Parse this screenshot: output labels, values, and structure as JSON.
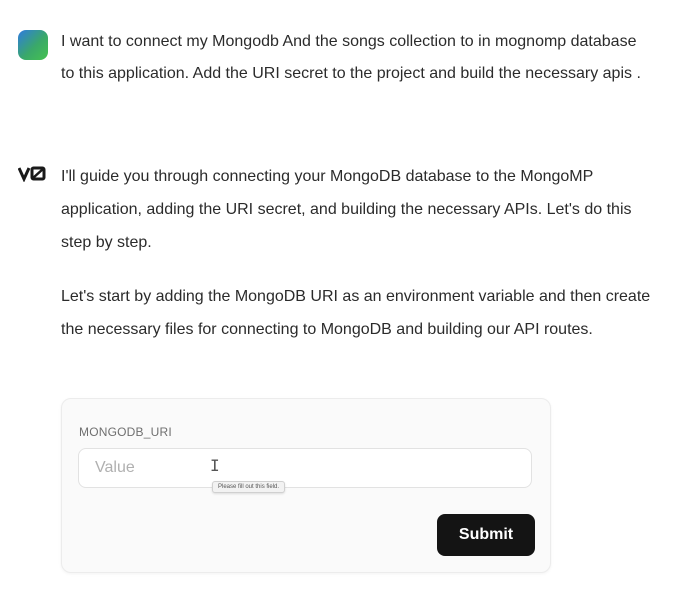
{
  "user_message": {
    "text": "I want to connect my Mongodb And the songs collection to in mognomp database to this application. Add the URI secret to the project and build the necessary apis ."
  },
  "assistant": {
    "logo": "v0",
    "paragraph_1": "I'll guide you through connecting your MongoDB database to the MongoMP application, adding the URI secret, and building the necessary APIs. Let's do this step by step.",
    "paragraph_2": "Let's start by adding the MongoDB URI as an environment variable and then create the necessary files for connecting to MongoDB and building our API routes."
  },
  "env_form": {
    "label": "MONGODB_URI",
    "placeholder": "Value",
    "value": "",
    "validation_tooltip": "Please fill out this field.",
    "submit_label": "Submit"
  },
  "colors": {
    "button_bg": "#141414",
    "card_bg": "#fafafa",
    "text": "#2b2b2b"
  }
}
